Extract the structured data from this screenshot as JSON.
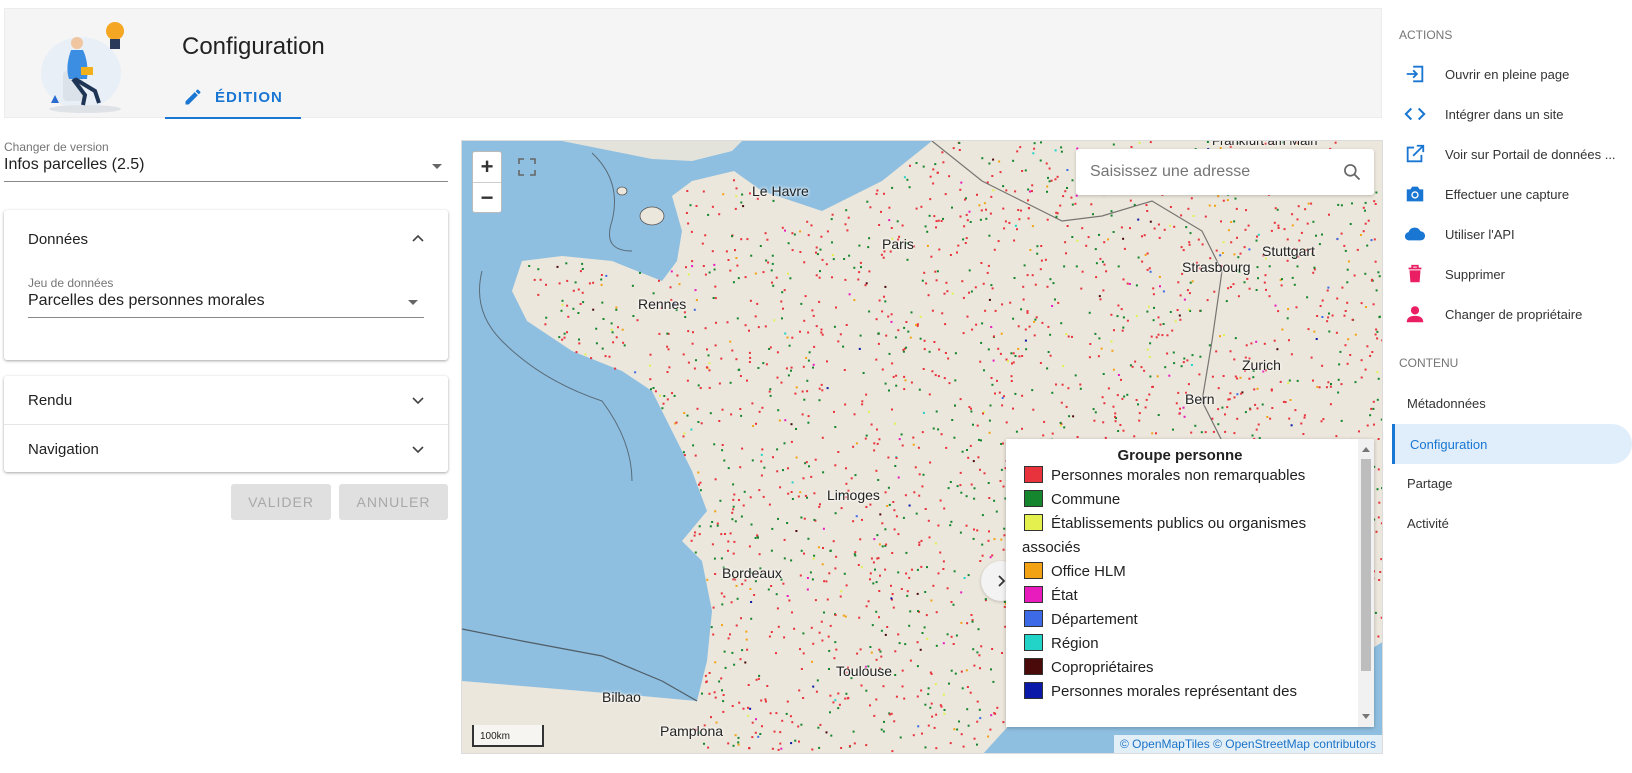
{
  "header": {
    "title": "Configuration",
    "tab_label": "ÉDITION"
  },
  "version": {
    "label": "Changer de version",
    "value": "Infos parcelles (2.5)"
  },
  "panels": {
    "donnees": {
      "title": "Données",
      "dataset_label": "Jeu de données",
      "dataset_value": "Parcelles des personnes morales"
    },
    "rendu": {
      "title": "Rendu"
    },
    "navigation": {
      "title": "Navigation"
    }
  },
  "buttons": {
    "validate": "VALIDER",
    "cancel": "ANNULER"
  },
  "map": {
    "search_placeholder": "Saisissez une adresse",
    "scale_label": "100km",
    "attribution": "© OpenMapTiles © OpenStreetMap contributors",
    "cities": [
      "Le Havre",
      "Paris",
      "Rennes",
      "Stuttgart",
      "Strasbourg",
      "Zurich",
      "Bern",
      "Limoges",
      "Bordeaux",
      "Toulouse",
      "Bilbao",
      "Pamplona",
      "Frankfurt am Main"
    ],
    "legend": {
      "title": "Groupe personne",
      "items": [
        {
          "label": "Personnes morales non remarquables",
          "color": "#e8333c"
        },
        {
          "label": "Commune",
          "color": "#16862e"
        },
        {
          "label": "Établissements publics ou organismes associés",
          "color": "#e3f04e"
        },
        {
          "label": "Office HLM",
          "color": "#f2a213"
        },
        {
          "label": "État",
          "color": "#e81bbd"
        },
        {
          "label": "Département",
          "color": "#3d6be8"
        },
        {
          "label": "Région",
          "color": "#22d3c8"
        },
        {
          "label": "Copropriétaires",
          "color": "#4a0a0a"
        },
        {
          "label": "Personnes morales représentant des",
          "color": "#0a19a8"
        }
      ]
    }
  },
  "sidebar": {
    "actions_label": "ACTIONS",
    "actions": [
      {
        "label": "Ouvrir en pleine page",
        "icon": "open-in-page-icon"
      },
      {
        "label": "Intégrer dans un site",
        "icon": "code-icon"
      },
      {
        "label": "Voir sur Portail de données ...",
        "icon": "external-link-icon"
      },
      {
        "label": "Effectuer une capture",
        "icon": "camera-icon"
      },
      {
        "label": "Utiliser l'API",
        "icon": "cloud-icon"
      },
      {
        "label": "Supprimer",
        "icon": "trash-icon"
      },
      {
        "label": "Changer de propriétaire",
        "icon": "person-icon"
      }
    ],
    "content_label": "CONTENU",
    "content": [
      {
        "label": "Métadonnées"
      },
      {
        "label": "Configuration"
      },
      {
        "label": "Partage"
      },
      {
        "label": "Activité"
      }
    ]
  },
  "colors": {
    "accent": "#1976d2",
    "delete": "#e91e63",
    "water": "#8fbfe0",
    "land": "#ece7dc"
  }
}
